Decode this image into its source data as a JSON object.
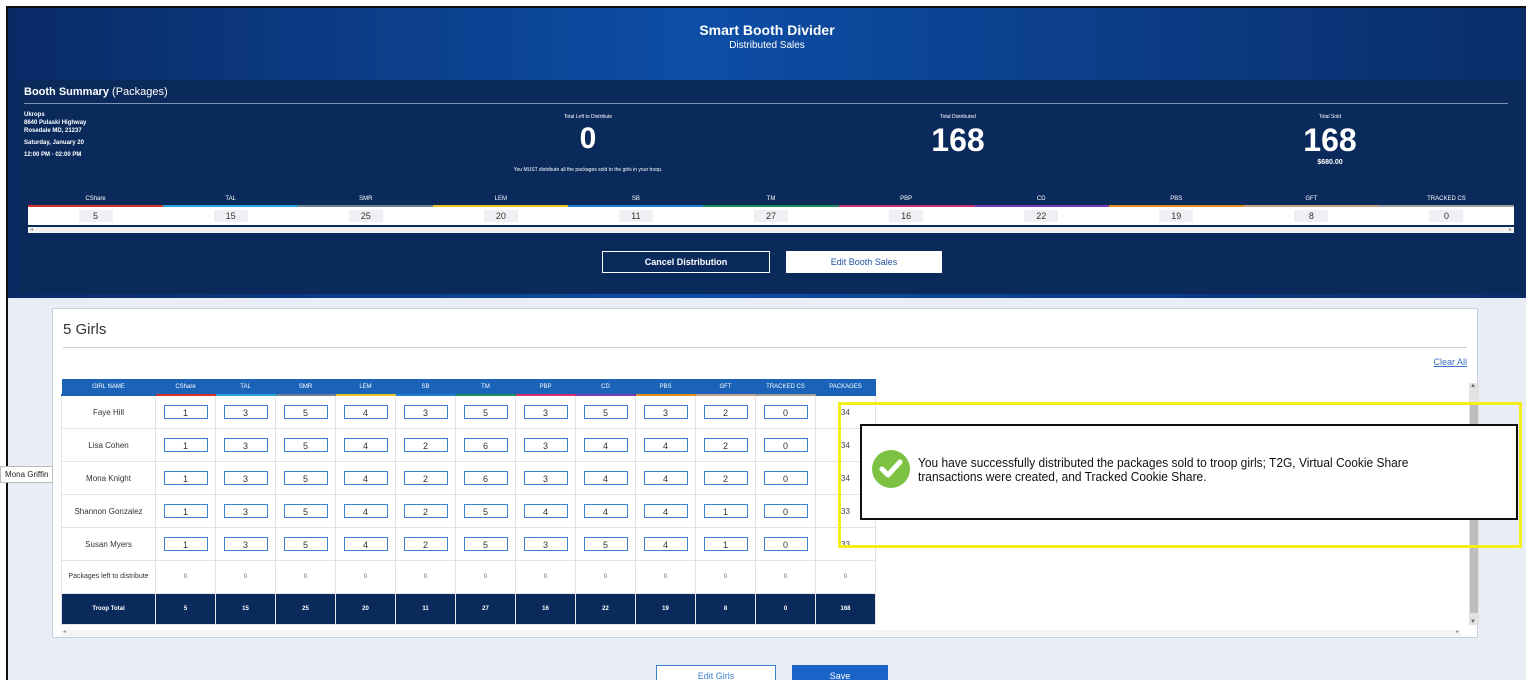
{
  "header": {
    "title": "Smart Booth Divider",
    "subtitle": "Distributed Sales"
  },
  "summary": {
    "title_bold": "Booth Summary",
    "title_rest": " (Packages)",
    "location": [
      "Ukrops",
      "8640 Pulaski Highway",
      "Rosedale MD, 21237"
    ],
    "date": "Saturday, January 20",
    "time": "12:00 PM - 02:00 PM",
    "left_label": "Total Left to Distribute",
    "left_value": "0",
    "left_note": "You MUST distribute all the packages sold to the girls in your troop.",
    "distributed_label": "Total Distributed",
    "distributed_value": "168",
    "sold_label": "Total Sold",
    "sold_value": "168",
    "sold_amount": "$680.00"
  },
  "varieties": {
    "headers": [
      "CShare",
      "TAL",
      "SMR",
      "LEM",
      "SB",
      "TM",
      "PBP",
      "CD",
      "PBS",
      "GFT",
      "TRACKED CS"
    ],
    "values": [
      "5",
      "15",
      "25",
      "20",
      "11",
      "27",
      "16",
      "22",
      "19",
      "8",
      "0"
    ],
    "colors": [
      "#d0312d",
      "#2fa3d9",
      "#6f7f96",
      "#e6c229",
      "#1f7fd1",
      "#1a8f5a",
      "#d22f6e",
      "#7b3fb5",
      "#e38f1c",
      "#c2a38a",
      "#9e9e9e"
    ]
  },
  "buttons": {
    "cancel": "Cancel Distribution",
    "edit_sales": "Edit Booth Sales",
    "edit_girls": "Edit Girls",
    "save": "Save"
  },
  "girls": {
    "title": "5 Girls",
    "clear_all": "Clear All",
    "name_header": "GIRL NAME",
    "packages_header": "PACKAGES",
    "rows": [
      {
        "name": "Faye Hill",
        "values": [
          "1",
          "3",
          "5",
          "4",
          "3",
          "5",
          "3",
          "5",
          "3",
          "2",
          "0"
        ],
        "packages": "34"
      },
      {
        "name": "Lisa Cohen",
        "values": [
          "1",
          "3",
          "5",
          "4",
          "2",
          "6",
          "3",
          "4",
          "4",
          "2",
          "0"
        ],
        "packages": "34"
      },
      {
        "name": "Mona Knight",
        "values": [
          "1",
          "3",
          "5",
          "4",
          "2",
          "6",
          "3",
          "4",
          "4",
          "2",
          "0"
        ],
        "packages": "34"
      },
      {
        "name": "Shannon Gonzalez",
        "values": [
          "1",
          "3",
          "5",
          "4",
          "2",
          "5",
          "4",
          "4",
          "4",
          "1",
          "0"
        ],
        "packages": "33"
      },
      {
        "name": "Susan Myers",
        "values": [
          "1",
          "3",
          "5",
          "4",
          "2",
          "5",
          "3",
          "5",
          "4",
          "1",
          "0"
        ],
        "packages": "33"
      }
    ],
    "left_label": "Packages left to distribute",
    "left_values": [
      "0",
      "0",
      "0",
      "0",
      "0",
      "0",
      "0",
      "0",
      "0",
      "0",
      "0",
      "0"
    ],
    "total_label": "Troop Total",
    "totals": [
      "5",
      "15",
      "25",
      "20",
      "11",
      "27",
      "16",
      "22",
      "19",
      "8",
      "0",
      "168"
    ]
  },
  "tooltip": "Mona Griffin",
  "toast": {
    "message": "You have successfully distributed the packages sold to troop girls; T2G, Virtual Cookie Share transactions were created, and Tracked Cookie Share."
  }
}
